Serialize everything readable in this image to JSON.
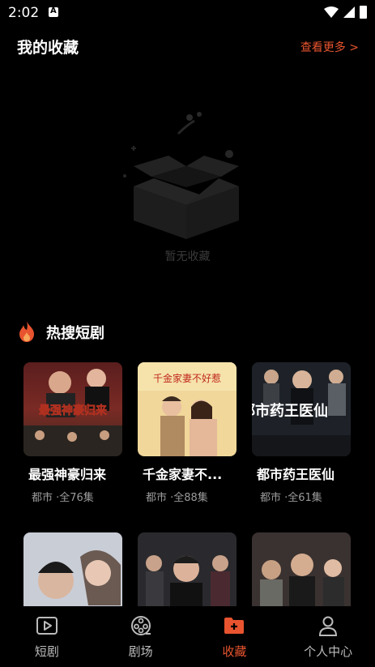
{
  "status_bar": {
    "time": "2:02",
    "app_icon": "a-icon"
  },
  "favorites": {
    "title": "我的收藏",
    "more_label": "查看更多 >",
    "empty_text": "暂无收藏",
    "empty_icon": "empty-box-icon"
  },
  "hot": {
    "title": "热搜短剧",
    "icon": "fire-icon",
    "icon_color": "#e8542f",
    "cards": [
      {
        "title": "最强神豪归来",
        "cover_text": "最强神豪归来",
        "meta": "都市 ·全76集"
      },
      {
        "title": "千金家妻不...",
        "cover_text": "千金家妻不好惹",
        "meta": "都市 ·全88集"
      },
      {
        "title": "都市药王医仙",
        "cover_text": "都市药王医仙",
        "meta": "都市 ·全61集"
      },
      {
        "title": "",
        "cover_text": "",
        "meta": ""
      },
      {
        "title": "",
        "cover_text": "",
        "meta": ""
      },
      {
        "title": "",
        "cover_text": "",
        "meta": ""
      }
    ]
  },
  "nav": {
    "accent": "#e8542f",
    "items": [
      {
        "label": "短剧",
        "icon": "play-icon",
        "active": false
      },
      {
        "label": "剧场",
        "icon": "film-reel-icon",
        "active": false
      },
      {
        "label": "收藏",
        "icon": "favorite-folder-icon",
        "active": true
      },
      {
        "label": "个人中心",
        "icon": "user-icon",
        "active": false
      }
    ]
  }
}
